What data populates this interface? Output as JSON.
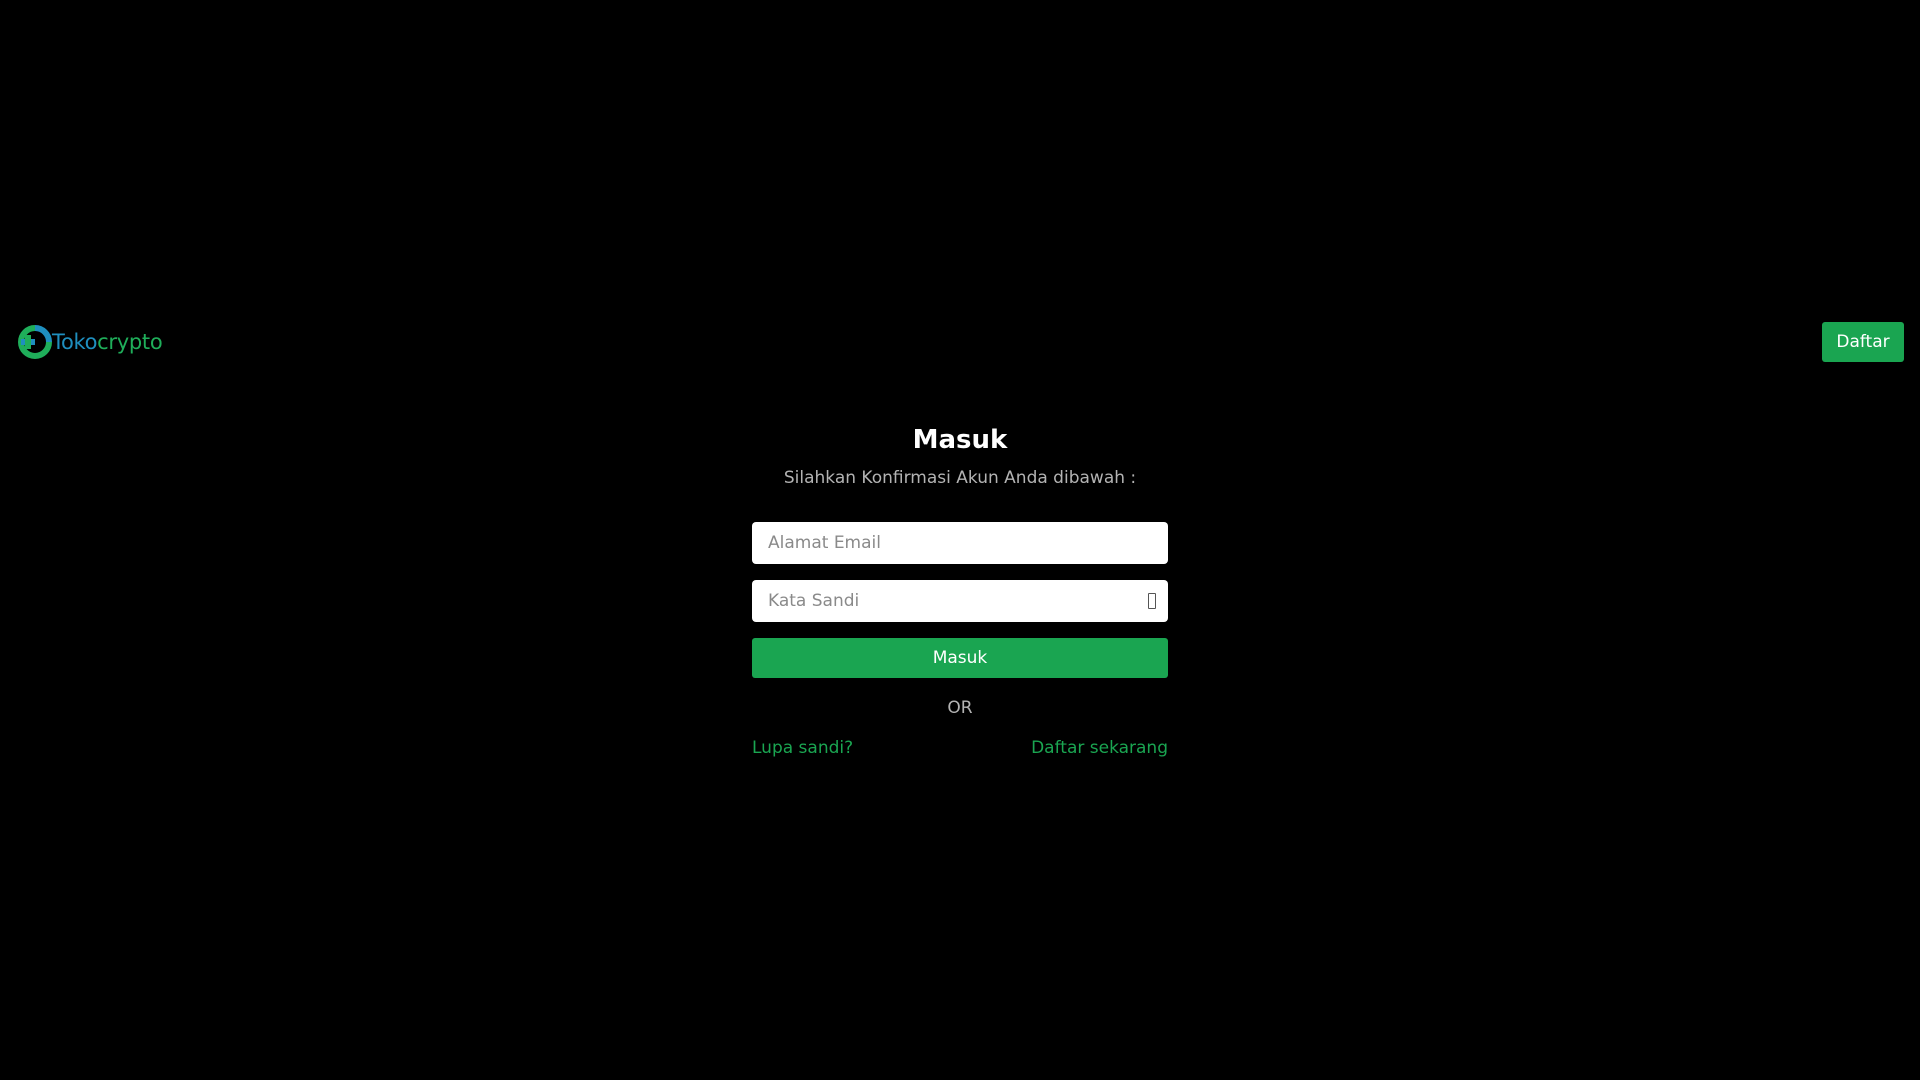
{
  "brand": {
    "name_part1": "Toko",
    "name_part2": "crypto",
    "colors": {
      "blue": "#1f8fbf",
      "green": "#1fae5a"
    }
  },
  "header": {
    "register_label": "Daftar"
  },
  "login": {
    "title": "Masuk",
    "subtitle": "Silahkan Konfirmasi Akun Anda dibawah :",
    "email_placeholder": "Alamat Email",
    "email_value": "",
    "password_placeholder": "Kata Sandi",
    "password_value": "",
    "password_toggle_icon": "eye-icon",
    "submit_label": "Masuk",
    "or_label": "OR",
    "forgot_label": "Lupa sandi?",
    "register_now_label": "Daftar sekarang"
  },
  "colors": {
    "background": "#000000",
    "accent": "#1aa551",
    "muted_text": "#b3b3b3"
  }
}
